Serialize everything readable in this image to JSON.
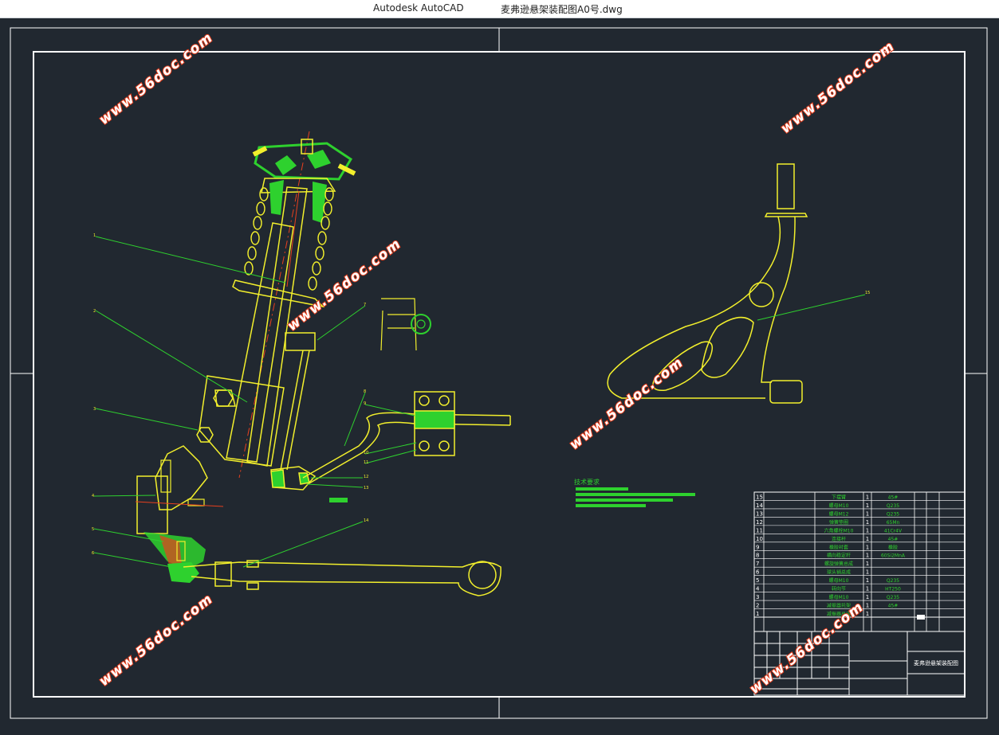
{
  "titlebar": {
    "app": "Autodesk AutoCAD",
    "document": "麦弗逊悬架装配图A0号.dwg"
  },
  "watermark": "www.56doc.com",
  "drawing": {
    "tech_req_title": "技术要求",
    "drawing_title": "麦弗逊悬架装配图",
    "leader_labels": [
      "1",
      "2",
      "3",
      "4",
      "5",
      "6",
      "7",
      "8",
      "9",
      "10",
      "11",
      "12",
      "13",
      "14",
      "15"
    ]
  },
  "bom": {
    "rows": [
      {
        "no": "15",
        "name": "下摆臂",
        "qty": "1",
        "material": "45#"
      },
      {
        "no": "14",
        "name": "螺母M10",
        "qty": "1",
        "material": "Q235"
      },
      {
        "no": "13",
        "name": "螺母M12",
        "qty": "1",
        "material": "Q235"
      },
      {
        "no": "12",
        "name": "弹簧垫圈",
        "qty": "1",
        "material": "65Mn"
      },
      {
        "no": "11",
        "name": "六角螺栓M10",
        "qty": "1",
        "material": "41Cr4V"
      },
      {
        "no": "10",
        "name": "连接杆",
        "qty": "1",
        "material": "45#"
      },
      {
        "no": "9",
        "name": "橡胶衬套",
        "qty": "1",
        "material": "橡胶"
      },
      {
        "no": "8",
        "name": "横向稳定杆",
        "qty": "1",
        "material": "60Si2MnA"
      },
      {
        "no": "7",
        "name": "螺旋弹簧总成",
        "qty": "1",
        "material": ""
      },
      {
        "no": "6",
        "name": "球头销总成",
        "qty": "1",
        "material": ""
      },
      {
        "no": "5",
        "name": "螺母M10",
        "qty": "1",
        "material": "Q235"
      },
      {
        "no": "4",
        "name": "转向节",
        "qty": "1",
        "material": "HT250"
      },
      {
        "no": "3",
        "name": "螺母M10",
        "qty": "1",
        "material": "Q235"
      },
      {
        "no": "2",
        "name": "减振器托架",
        "qty": "1",
        "material": "45#"
      },
      {
        "no": "1",
        "name": "减振器总成",
        "qty": "1",
        "material": ""
      }
    ]
  },
  "colors": {
    "background": "#212830",
    "border": "#ffffff",
    "part": "#f2ef2c",
    "leader": "#2ed12e",
    "section": "#e8401e",
    "watermark": "#e8401e"
  }
}
